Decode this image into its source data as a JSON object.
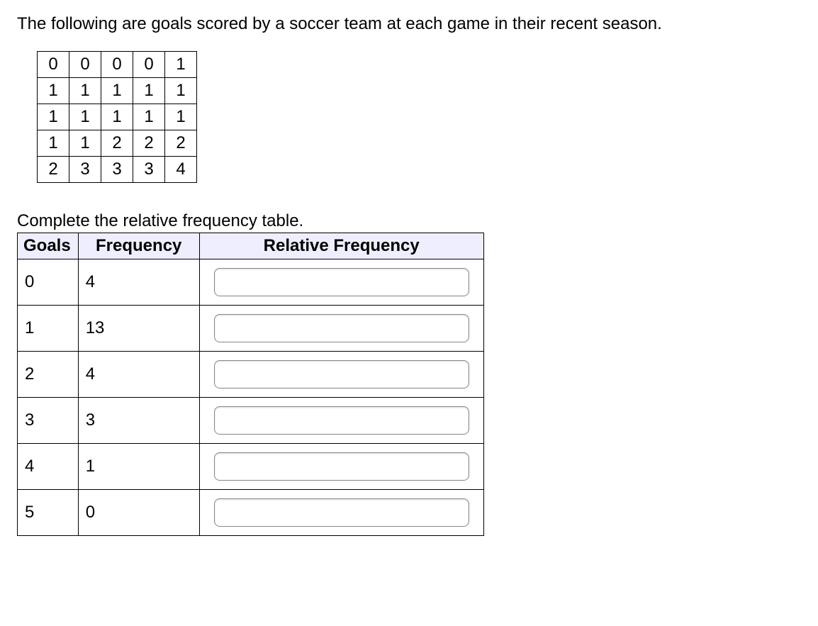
{
  "intro_text": "The following are goals scored by a soccer team at each game in their recent season.",
  "data_grid": [
    [
      "0",
      "0",
      "0",
      "0",
      "1"
    ],
    [
      "1",
      "1",
      "1",
      "1",
      "1"
    ],
    [
      "1",
      "1",
      "1",
      "1",
      "1"
    ],
    [
      "1",
      "1",
      "2",
      "2",
      "2"
    ],
    [
      "2",
      "3",
      "3",
      "3",
      "4"
    ]
  ],
  "instruction_text": "Complete the relative frequency table.",
  "freq_table": {
    "headers": {
      "goals": "Goals",
      "frequency": "Frequency",
      "relative_frequency": "Relative Frequency"
    },
    "rows": [
      {
        "goals": "0",
        "frequency": "4",
        "rel": ""
      },
      {
        "goals": "1",
        "frequency": "13",
        "rel": ""
      },
      {
        "goals": "2",
        "frequency": "4",
        "rel": ""
      },
      {
        "goals": "3",
        "frequency": "3",
        "rel": ""
      },
      {
        "goals": "4",
        "frequency": "1",
        "rel": ""
      },
      {
        "goals": "5",
        "frequency": "0",
        "rel": ""
      }
    ]
  }
}
